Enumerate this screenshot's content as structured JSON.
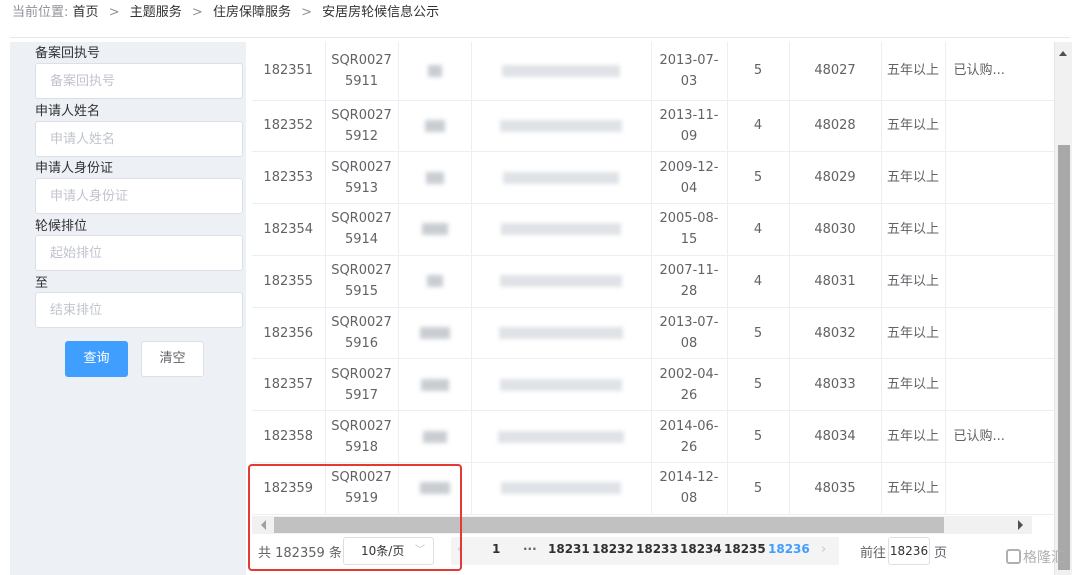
{
  "breadcrumb": {
    "prefix": "当前位置:",
    "items": [
      "首页",
      "主题服务",
      "住房保障服务"
    ],
    "separator": ">",
    "current": "安居房轮候信息公示"
  },
  "filters": {
    "fields": [
      {
        "label": "备案回执号",
        "placeholder": "备案回执号",
        "value": ""
      },
      {
        "label": "申请人姓名",
        "placeholder": "申请人姓名",
        "value": ""
      },
      {
        "label": "申请人身份证",
        "placeholder": "申请人身份证",
        "value": ""
      },
      {
        "label": "轮候排位",
        "placeholder": "起始排位",
        "value": ""
      },
      {
        "label": "至",
        "placeholder": "结束排位",
        "value": ""
      }
    ],
    "search_label": "查询",
    "clear_label": "清空"
  },
  "table": {
    "rows": [
      {
        "rank": "182351",
        "receipt": "SQR00275911",
        "date": "2013-07-03",
        "members": "5",
        "seq": "48027",
        "years": "五年以上",
        "status": "已认购..."
      },
      {
        "rank": "182352",
        "receipt": "SQR00275912",
        "date": "2013-11-09",
        "members": "4",
        "seq": "48028",
        "years": "五年以上",
        "status": ""
      },
      {
        "rank": "182353",
        "receipt": "SQR00275913",
        "date": "2009-12-04",
        "members": "5",
        "seq": "48029",
        "years": "五年以上",
        "status": ""
      },
      {
        "rank": "182354",
        "receipt": "SQR00275914",
        "date": "2005-08-15",
        "members": "4",
        "seq": "48030",
        "years": "五年以上",
        "status": ""
      },
      {
        "rank": "182355",
        "receipt": "SQR00275915",
        "date": "2007-11-28",
        "members": "4",
        "seq": "48031",
        "years": "五年以上",
        "status": ""
      },
      {
        "rank": "182356",
        "receipt": "SQR00275916",
        "date": "2013-07-08",
        "members": "5",
        "seq": "48032",
        "years": "五年以上",
        "status": ""
      },
      {
        "rank": "182357",
        "receipt": "SQR00275917",
        "date": "2002-04-26",
        "members": "5",
        "seq": "48033",
        "years": "五年以上",
        "status": ""
      },
      {
        "rank": "182358",
        "receipt": "SQR00275918",
        "date": "2014-06-26",
        "members": "5",
        "seq": "48034",
        "years": "五年以上",
        "status": "已认购..."
      },
      {
        "rank": "182359",
        "receipt": "SQR00275919",
        "date": "2014-12-08",
        "members": "5",
        "seq": "48035",
        "years": "五年以上",
        "status": ""
      }
    ]
  },
  "pagination": {
    "total_text": "共 182359 条",
    "page_size": "10条/页",
    "first_page": "1",
    "ellipsis": "···",
    "pages": [
      "18231",
      "18232",
      "18233",
      "18234",
      "18235"
    ],
    "current_page": "18236",
    "goto_label": "前往",
    "goto_value": "18236",
    "page_unit": "页"
  },
  "watermark": "格隆汇",
  "colors": {
    "primary": "#409eff",
    "highlight": "#e53935",
    "sidebar_bg": "#edf0f5"
  }
}
